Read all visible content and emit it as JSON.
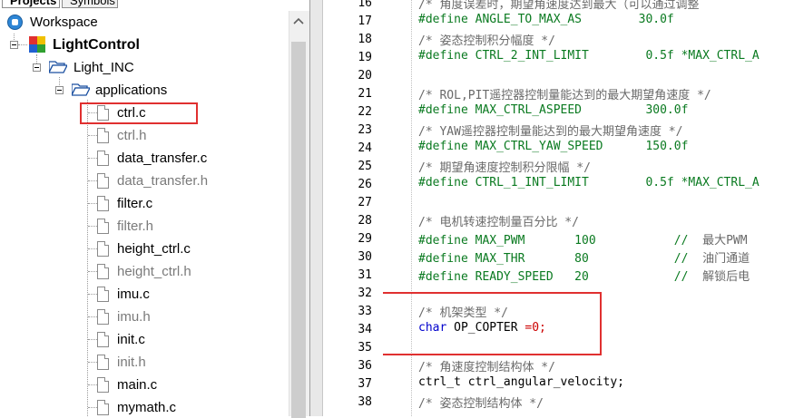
{
  "panel": {
    "tabs": [
      "Projects",
      "Symbols"
    ]
  },
  "tree": {
    "workspace": "Workspace",
    "project": "LightControl",
    "group": "Light_INC",
    "folder": "applications",
    "files": [
      {
        "name": "ctrl.c",
        "dim": false
      },
      {
        "name": "ctrl.h",
        "dim": true
      },
      {
        "name": "data_transfer.c",
        "dim": false
      },
      {
        "name": "data_transfer.h",
        "dim": true
      },
      {
        "name": "filter.c",
        "dim": false
      },
      {
        "name": "filter.h",
        "dim": true
      },
      {
        "name": "height_ctrl.c",
        "dim": false
      },
      {
        "name": "height_ctrl.h",
        "dim": true
      },
      {
        "name": "imu.c",
        "dim": false
      },
      {
        "name": "imu.h",
        "dim": true
      },
      {
        "name": "init.c",
        "dim": false
      },
      {
        "name": "init.h",
        "dim": true
      },
      {
        "name": "main.c",
        "dim": false
      },
      {
        "name": "mymath.c",
        "dim": false
      }
    ]
  },
  "editor": {
    "lines": [
      {
        "n": "16",
        "parts": [
          {
            "t": "/* 角度误差时，期望角速度达到最大（可以通过调整",
            "c": "cmt"
          }
        ]
      },
      {
        "n": "17",
        "parts": [
          {
            "t": "#define ANGLE_TO_MAX_AS        30.0f",
            "c": "pp"
          }
        ]
      },
      {
        "n": "18",
        "parts": [
          {
            "t": "/* 姿态控制积分幅度 */",
            "c": "cmt"
          }
        ]
      },
      {
        "n": "19",
        "parts": [
          {
            "t": "#define CTRL_2_INT_LIMIT        0.5f *MAX_CTRL_A",
            "c": "pp"
          }
        ]
      },
      {
        "n": "20",
        "parts": []
      },
      {
        "n": "21",
        "parts": [
          {
            "t": "/* ROL,PIT遥控器控制量能达到的最大期望角速度 */",
            "c": "cmt"
          }
        ]
      },
      {
        "n": "22",
        "parts": [
          {
            "t": "#define MAX_CTRL_ASPEED         300.0f",
            "c": "pp"
          }
        ]
      },
      {
        "n": "23",
        "parts": [
          {
            "t": "/* YAW遥控器控制量能达到的最大期望角速度 */",
            "c": "cmt"
          }
        ]
      },
      {
        "n": "24",
        "parts": [
          {
            "t": "#define MAX_CTRL_YAW_SPEED      150.0f",
            "c": "pp"
          }
        ]
      },
      {
        "n": "25",
        "parts": [
          {
            "t": "/* 期望角速度控制积分限幅 */",
            "c": "cmt"
          }
        ]
      },
      {
        "n": "26",
        "parts": [
          {
            "t": "#define CTRL_1_INT_LIMIT        0.5f *MAX_CTRL_A",
            "c": "pp"
          }
        ]
      },
      {
        "n": "27",
        "parts": []
      },
      {
        "n": "28",
        "parts": [
          {
            "t": "/* 电机转速控制量百分比 */",
            "c": "cmt"
          }
        ]
      },
      {
        "n": "29",
        "parts": [
          {
            "t": "#define MAX_PWM       100           //  ",
            "c": "pp"
          },
          {
            "t": "最大PWM",
            "c": "cmt"
          }
        ]
      },
      {
        "n": "30",
        "parts": [
          {
            "t": "#define MAX_THR       80            //  ",
            "c": "pp"
          },
          {
            "t": "油门通道",
            "c": "cmt"
          }
        ]
      },
      {
        "n": "31",
        "parts": [
          {
            "t": "#define READY_SPEED   20            //  ",
            "c": "pp"
          },
          {
            "t": "解锁后电",
            "c": "cmt"
          }
        ]
      },
      {
        "n": "32",
        "parts": []
      },
      {
        "n": "33",
        "parts": [
          {
            "t": "/* 机架类型 */",
            "c": "cmt"
          }
        ]
      },
      {
        "n": "34",
        "parts": [
          {
            "t": "char",
            "c": "kw"
          },
          {
            "t": " OP_COPTER ",
            "c": "plain"
          },
          {
            "t": "=",
            "c": "op"
          },
          {
            "t": "0;",
            "c": "op"
          }
        ]
      },
      {
        "n": "35",
        "parts": []
      },
      {
        "n": "36",
        "parts": [
          {
            "t": "/* 角速度控制结构体 */",
            "c": "cmt"
          }
        ]
      },
      {
        "n": "37",
        "parts": [
          {
            "t": "ctrl_t ctrl_angular_velocity;",
            "c": "plain"
          }
        ]
      },
      {
        "n": "38",
        "parts": [
          {
            "t": "/* 姿态控制结构体 */",
            "c": "cmt"
          }
        ]
      }
    ]
  },
  "colors": {
    "highlight": "#e03030",
    "preprocessor": "#0a7a20",
    "comment": "#6a6a6a",
    "keyword": "#0000cc"
  },
  "icons": [
    "workspace-icon",
    "project-icon",
    "folder-open-icon",
    "file-icon",
    "scroll-up-icon"
  ]
}
